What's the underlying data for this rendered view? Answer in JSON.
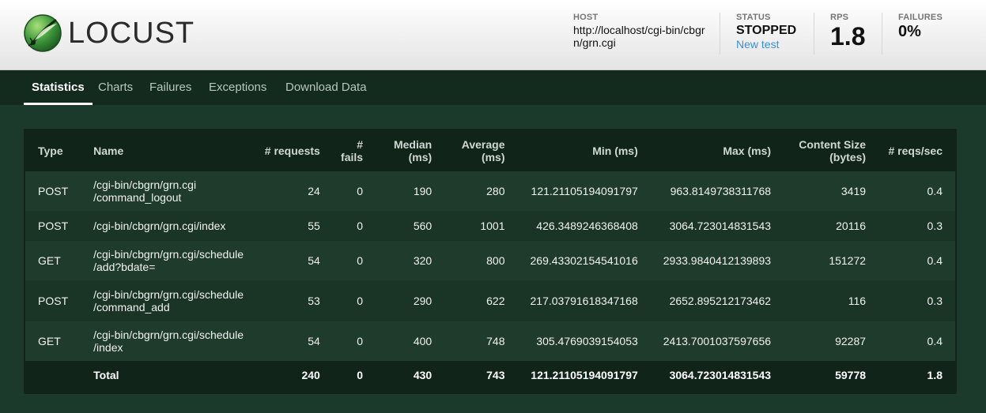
{
  "brand": {
    "name": "LOCUST"
  },
  "header": {
    "host": {
      "label": "HOST",
      "value": "http://localhost/cgi-bin/cbgrn/grn.cgi"
    },
    "status": {
      "label": "STATUS",
      "value": "STOPPED",
      "action": "New test"
    },
    "rps": {
      "label": "RPS",
      "value": "1.8"
    },
    "failures": {
      "label": "FAILURES",
      "value": "0%"
    }
  },
  "nav": {
    "tabs": [
      {
        "label": "Statistics",
        "active": true
      },
      {
        "label": "Charts",
        "active": false
      },
      {
        "label": "Failures",
        "active": false
      },
      {
        "label": "Exceptions",
        "active": false
      },
      {
        "label": "Download Data",
        "active": false
      }
    ]
  },
  "table": {
    "columns": [
      "Type",
      "Name",
      "# requests",
      "# fails",
      "Median (ms)",
      "Average (ms)",
      "Min (ms)",
      "Max (ms)",
      "Content Size (bytes)",
      "# reqs/sec"
    ],
    "rows": [
      [
        "POST",
        "/cgi-bin/cbgrn/grn.cgi /command_logout",
        "24",
        "0",
        "190",
        "280",
        "121.21105194091797",
        "963.8149738311768",
        "3419",
        "0.4"
      ],
      [
        "POST",
        "/cgi-bin/cbgrn/grn.cgi/index",
        "55",
        "0",
        "560",
        "1001",
        "426.3489246368408",
        "3064.723014831543",
        "20116",
        "0.3"
      ],
      [
        "GET",
        "/cgi-bin/cbgrn/grn.cgi/schedule /add?bdate=",
        "54",
        "0",
        "320",
        "800",
        "269.43302154541016",
        "2933.9840412139893",
        "151272",
        "0.4"
      ],
      [
        "POST",
        "/cgi-bin/cbgrn/grn.cgi/schedule /command_add",
        "53",
        "0",
        "290",
        "622",
        "217.03791618347168",
        "2652.895212173462",
        "116",
        "0.3"
      ],
      [
        "GET",
        "/cgi-bin/cbgrn/grn.cgi/schedule /index",
        "54",
        "0",
        "400",
        "748",
        "305.4769039154053",
        "2413.7001037597656",
        "92287",
        "0.4"
      ]
    ],
    "total": [
      "",
      "Total",
      "240",
      "0",
      "430",
      "743",
      "121.21105194091797",
      "3064.723014831543",
      "59778",
      "1.8"
    ]
  },
  "colors": {
    "background": "#1b3a2b",
    "nav": "#132a1e",
    "accent_link": "#3b8fd6"
  }
}
